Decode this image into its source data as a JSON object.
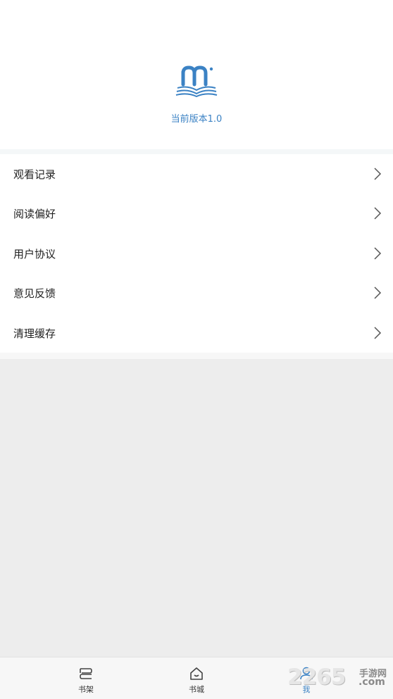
{
  "header": {
    "version_text": "当前版本1.0",
    "accent_color": "#3b82c4"
  },
  "menu": {
    "items": [
      {
        "label": "观看记录"
      },
      {
        "label": "阅读偏好"
      },
      {
        "label": "用户协议"
      },
      {
        "label": "意见反馈"
      },
      {
        "label": "清理缓存"
      }
    ]
  },
  "tabbar": {
    "tabs": [
      {
        "label": "书架",
        "icon": "bookshelf-icon"
      },
      {
        "label": "书城",
        "icon": "home-icon"
      },
      {
        "label": "我",
        "icon": "user-icon",
        "active": true
      }
    ]
  },
  "watermark": {
    "number": "2265",
    "site_cn": "手游网",
    "site_en": ".com"
  }
}
